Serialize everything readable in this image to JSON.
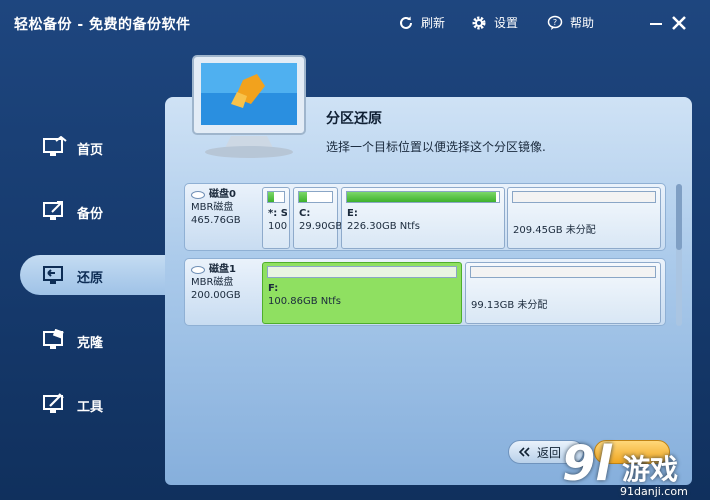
{
  "window": {
    "title": "轻松备份 - 免费的备份软件",
    "actions": {
      "refresh": "刷新",
      "settings": "设置",
      "help": "帮助"
    }
  },
  "nav": {
    "items": [
      {
        "label": "首页",
        "icon": "home-monitor-icon",
        "active": false
      },
      {
        "label": "备份",
        "icon": "backup-icon",
        "active": false
      },
      {
        "label": "还原",
        "icon": "restore-icon",
        "active": true
      },
      {
        "label": "克隆",
        "icon": "clone-icon",
        "active": false
      },
      {
        "label": "工具",
        "icon": "tools-icon",
        "active": false
      }
    ]
  },
  "panel": {
    "title": "分区还原",
    "subtitle": "选择一个目标位置以便选择这个分区镜像."
  },
  "disks": [
    {
      "name": "磁盘0",
      "type": "MBR磁盘",
      "size": "465.76GB",
      "partitions": [
        {
          "name": "*: S",
          "info": "100.",
          "used": 0.4,
          "selected": false
        },
        {
          "name": "C:",
          "info": "29.90GB",
          "used": 0.25,
          "selected": false
        },
        {
          "name": "E:",
          "info": "226.30GB Ntfs",
          "used": 0.98,
          "selected": false
        },
        {
          "name": "",
          "info": "209.45GB 未分配",
          "used": 0,
          "selected": false
        }
      ]
    },
    {
      "name": "磁盘1",
      "type": "MBR磁盘",
      "size": "200.00GB",
      "partitions": [
        {
          "name": "F:",
          "info": "100.86GB Ntfs",
          "used": 0.0,
          "selected": true
        },
        {
          "name": "",
          "info": "99.13GB 未分配",
          "used": 0,
          "selected": false
        }
      ]
    }
  ],
  "footer": {
    "back_label": "返回"
  },
  "watermark": {
    "num": "9l",
    "text": "游戏",
    "url": "91danji.com"
  },
  "colors": {
    "accent": "#1e467f",
    "selected_partition": "#8fe061",
    "used_bar": "#3eb12c"
  }
}
